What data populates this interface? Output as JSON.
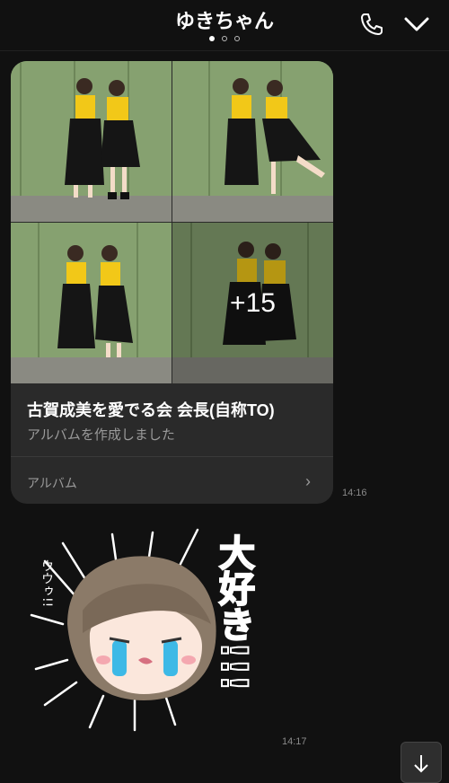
{
  "header": {
    "title": "ゆきちゃん",
    "page_dots": 3,
    "active_dot": 1
  },
  "album": {
    "more_count": "+15",
    "name": "古賀成美を愛でる会 会長(自称TO)",
    "subtitle": "アルバムを作成しました",
    "footer_label": "アルバム",
    "time": "14:16"
  },
  "sticker": {
    "text": "大好き!!!",
    "sound": "ウウゥ!!",
    "time": "14:17"
  },
  "colors": {
    "background": "#111111",
    "card": "#2a2a2a",
    "shirt": "#f2c818"
  }
}
